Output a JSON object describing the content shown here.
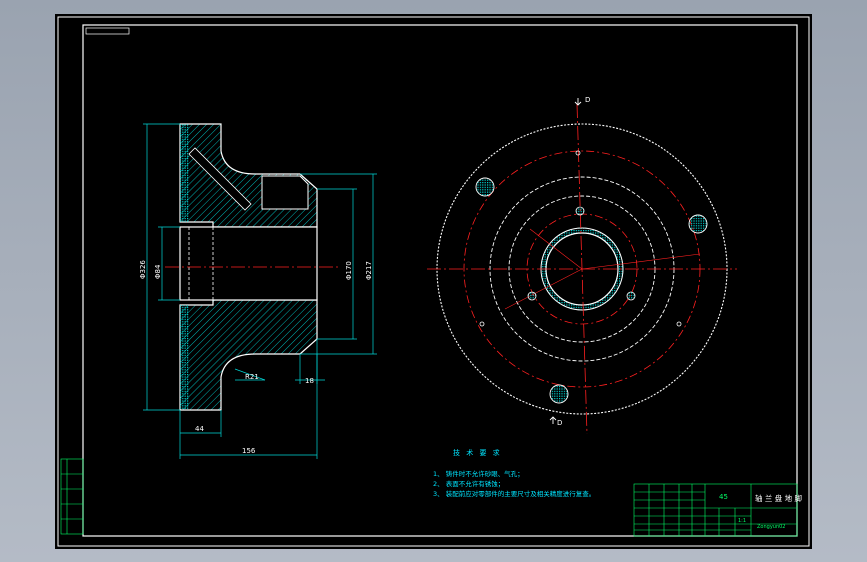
{
  "colors": {
    "outline": "#ffffff",
    "dimension": "#00d8d8",
    "center_line": "#ff2020",
    "hatch": "#00c8c8",
    "title_block": "#00ff66"
  },
  "dimensions": {
    "outer_diameter": "Φ326",
    "bore_diameter": "Φ84",
    "hub_diameter": "Φ170",
    "step_diameter": "Φ217",
    "fillet_radius": "R21",
    "hub_length": "18",
    "flange_thickness": "44",
    "total_length": "156"
  },
  "section_marks": {
    "top": "D",
    "bottom": "D"
  },
  "technical_requirements": {
    "title": "技 术 要 求",
    "items": [
      "1、 铸件时不允许砂眼、气孔；",
      "2、 表面不允许有锈蚀；",
      "3、 装配前应对零部件的主要尺寸及相关精度进行复查。"
    ]
  },
  "title_block": {
    "material": "45",
    "part_name": "轴 兰 盘 地 脚",
    "drawing_no": "Zongyun02",
    "scale": "1:1"
  }
}
